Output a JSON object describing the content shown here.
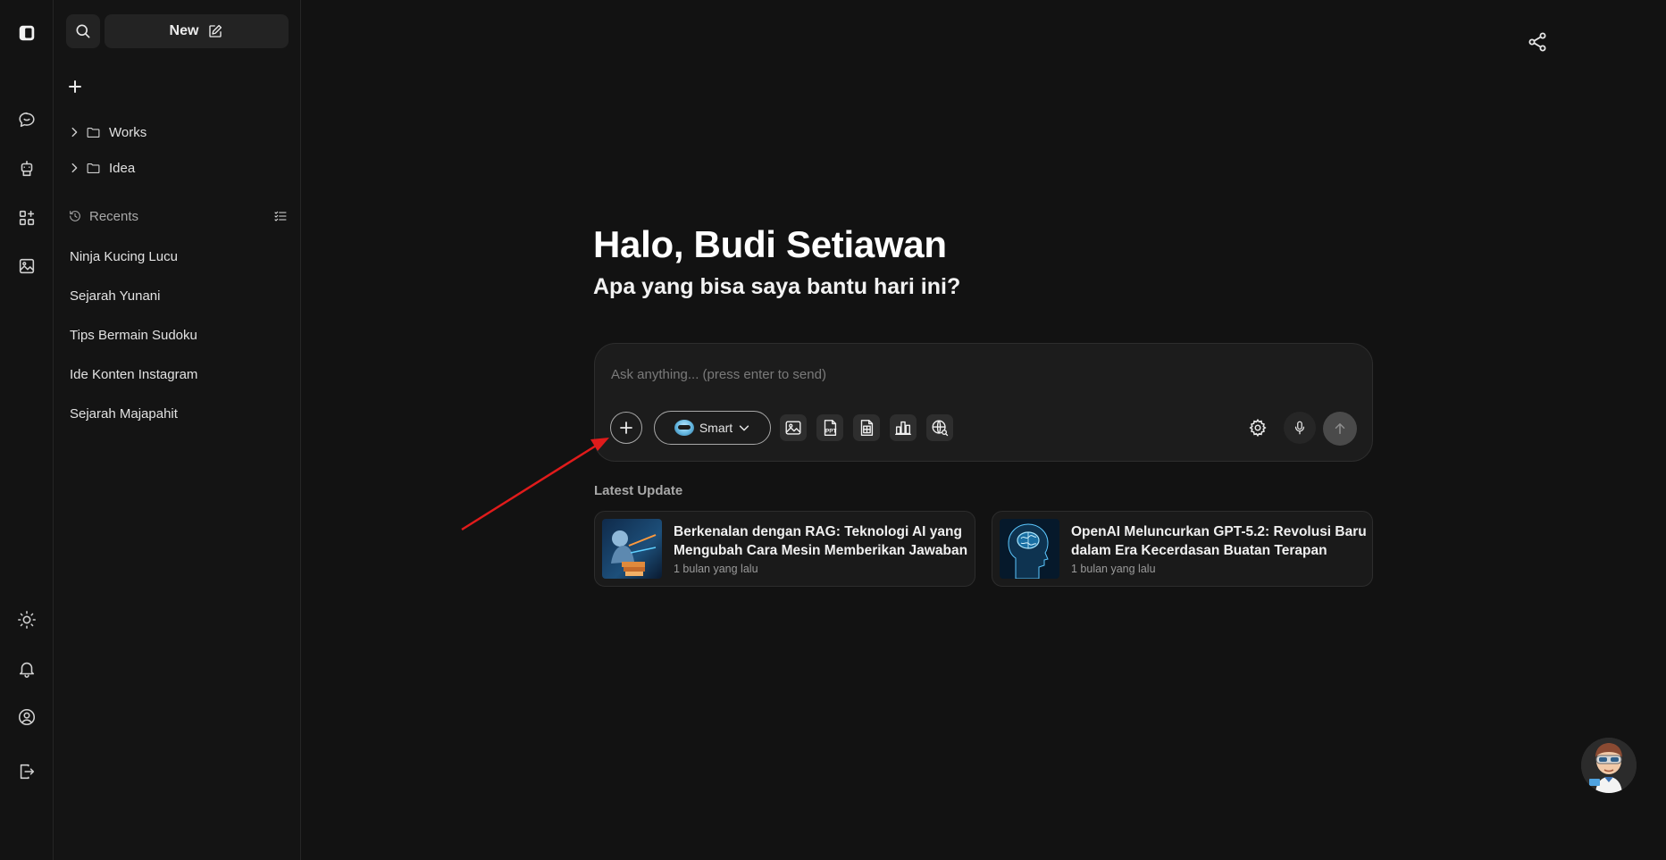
{
  "sidebar": {
    "new_label": "New",
    "folders": [
      {
        "label": "Works"
      },
      {
        "label": "Idea"
      }
    ],
    "recents_label": "Recents",
    "recents": [
      {
        "label": "Ninja Kucing Lucu"
      },
      {
        "label": "Sejarah Yunani"
      },
      {
        "label": "Tips Bermain Sudoku"
      },
      {
        "label": "Ide Konten Instagram"
      },
      {
        "label": "Sejarah Majapahit"
      }
    ]
  },
  "greeting": {
    "title": "Halo, Budi Setiawan",
    "subtitle": "Apa yang bisa saya bantu hari ini?"
  },
  "composer": {
    "placeholder": "Ask anything... (press enter to send)",
    "mode_label": "Smart",
    "tools": [
      "image-icon",
      "ppt-icon",
      "spreadsheet-icon",
      "chart-icon",
      "web-search-icon"
    ]
  },
  "latest_update": {
    "label": "Latest Update",
    "cards": [
      {
        "title": "Berkenalan dengan RAG: Teknologi AI yang Mengubah Cara Mesin Memberikan Jawaban",
        "time": "1 bulan yang lalu"
      },
      {
        "title": "OpenAI Meluncurkan GPT-5.2: Revolusi Baru dalam Era Kecerdasan Buatan Terapan",
        "time": "1 bulan yang lalu"
      }
    ]
  },
  "colors": {
    "background": "#121212",
    "surface": "#1c1c1c",
    "annotation_arrow": "#e01b1b"
  }
}
